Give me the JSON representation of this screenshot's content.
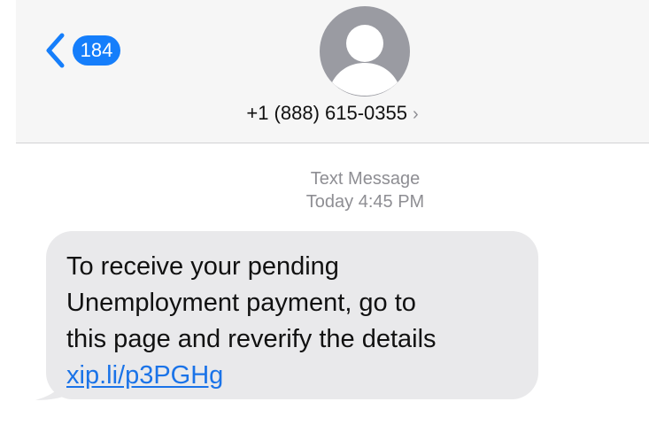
{
  "header": {
    "back_badge": "184",
    "contact_phone": "+1 (888) 615-0355"
  },
  "message_meta": {
    "service_label": "Text Message",
    "timestamp": "Today 4:45 PM"
  },
  "message": {
    "lines": [
      "To receive your pending",
      "Unemployment payment, go to",
      "this page and reverify the details"
    ],
    "link_text": "xip.li/p3PGHg"
  },
  "icons": {
    "back": "chevron-left-icon",
    "contact_detail": "chevron-right-icon",
    "avatar": "person-silhouette-icon"
  },
  "colors": {
    "accent": "#157efb",
    "link": "#1a73e8",
    "bubble": "#e9e9eb",
    "header": "#f6f6f6",
    "meta_text": "#8e8e93",
    "avatar_bg": "#9a9ba2"
  }
}
